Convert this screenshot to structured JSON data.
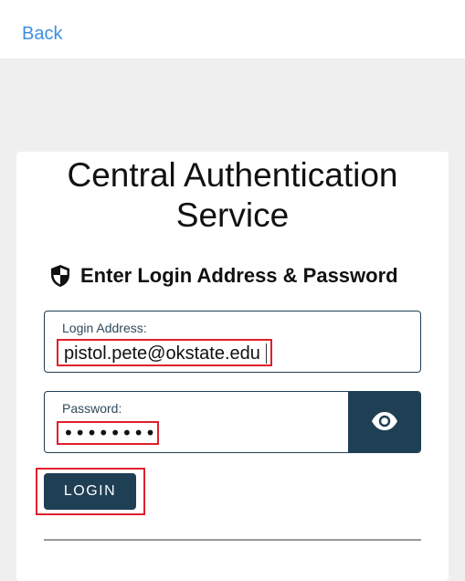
{
  "nav": {
    "back_label": "Back"
  },
  "card": {
    "title": "Central Authentication Service",
    "subtitle": "Enter Login Address & Password"
  },
  "form": {
    "login": {
      "label": "Login Address:",
      "value": "pistol.pete@okstate.edu"
    },
    "password": {
      "label": "Password:",
      "masked_value": "••••••••"
    },
    "submit_label": "LOGIN"
  },
  "colors": {
    "accent_dark": "#1f3f55",
    "link_blue": "#3d8fe0",
    "highlight_red": "#e21f2b"
  },
  "icons": {
    "shield": "shield-icon",
    "eye": "eye-icon"
  }
}
